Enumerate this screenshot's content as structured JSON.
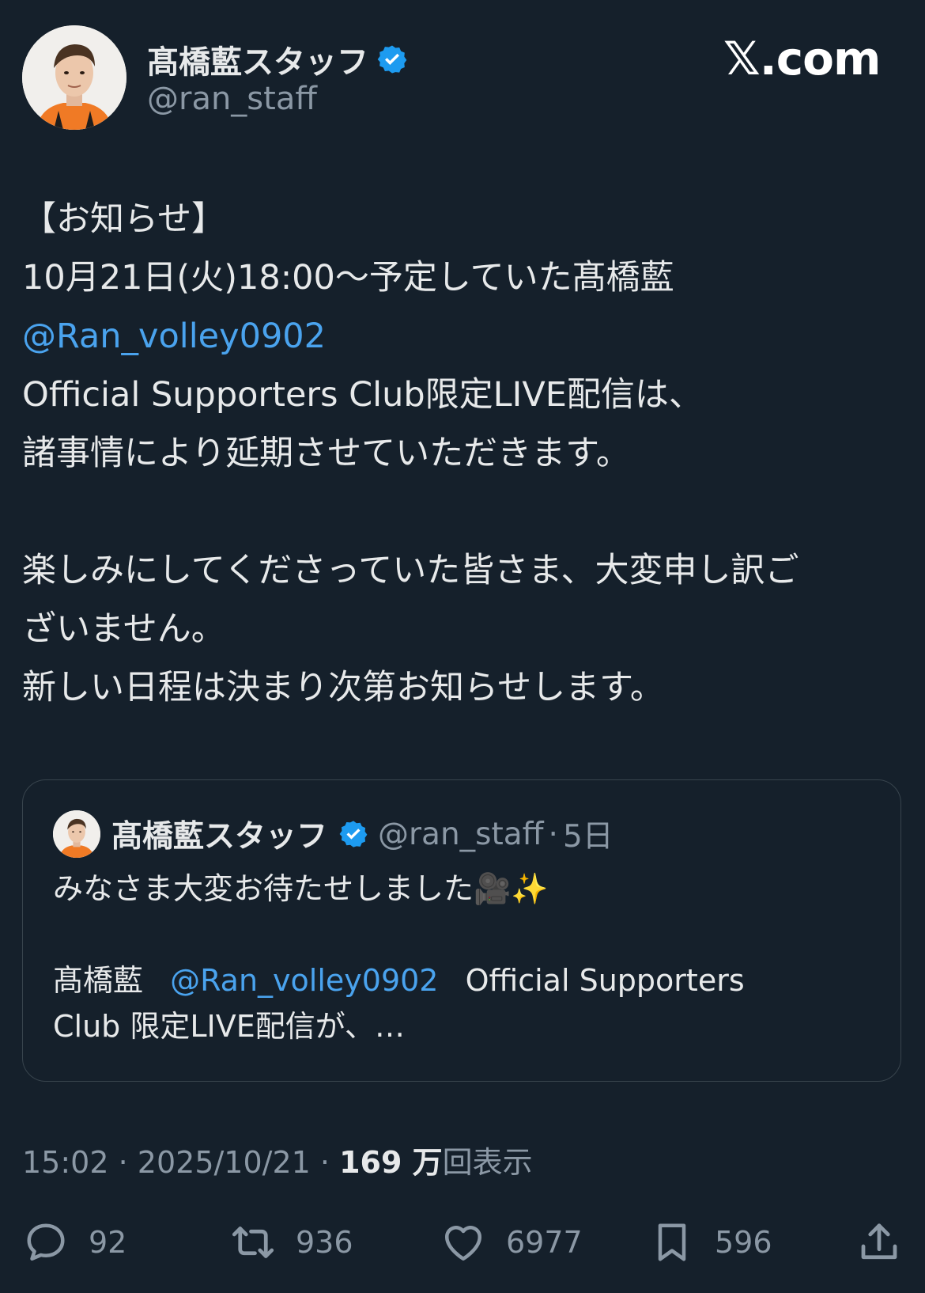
{
  "brand": "𝕏.com",
  "author": {
    "name": "髙橋藍スタッフ",
    "handle": "@ran_staff"
  },
  "tweet": {
    "lines": [
      "【お知らせ】",
      "10月21日(火)18:00〜予定していた髙橋藍",
      "@Ran_volley0902",
      "Official Supporters Club限定LIVE配信は、",
      "諸事情により延期させていただきます。",
      "",
      "楽しみにしてくださっていた皆さま、大変申し訳ご",
      "ざいません。",
      "新しい日程は決まり次第お知らせします。"
    ]
  },
  "quote": {
    "name": "髙橋藍スタッフ",
    "handle": "@ran_staff",
    "time": "5日",
    "separator": "·",
    "line1": "みなさま大変お待たせしました🎥✨",
    "line2_prefix": "髙橋藍",
    "line2_mention": "@Ran_volley0902",
    "line2_suffix": "Official Supporters",
    "line3": "Club 限定LIVE配信が、…"
  },
  "timestamp": {
    "time": "15:02",
    "date": "2025/10/21",
    "separator": "·",
    "views_count": "169 万",
    "views_label": "回表示"
  },
  "actions": {
    "replies": "92",
    "retweets": "936",
    "likes": "6977",
    "bookmarks": "596"
  },
  "colors": {
    "background": "#15202b",
    "mention": "#4aa3ee",
    "verified": "#1d9bf0",
    "muted": "#8b98a5"
  }
}
